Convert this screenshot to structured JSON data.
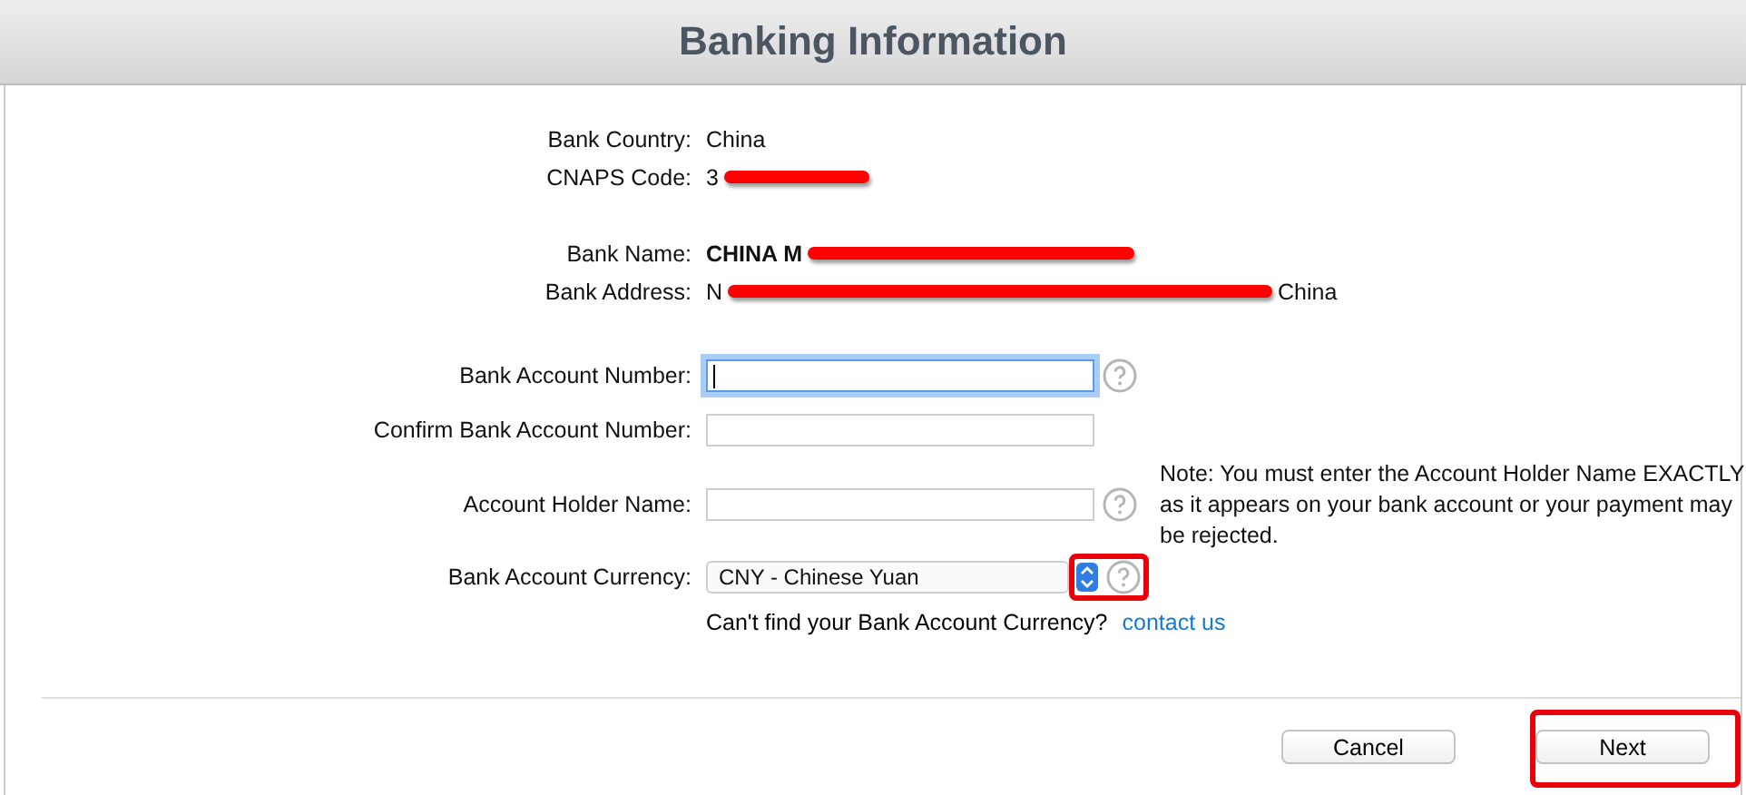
{
  "window": {
    "title": "Banking Information"
  },
  "bank_details": [
    {
      "rows": [
        {
          "label": "Bank Country:",
          "value": "China",
          "bold": false,
          "redacted": false
        },
        {
          "label": "CNAPS Code:",
          "value": "3",
          "bold": false,
          "redacted": true
        }
      ]
    },
    {
      "rows": [
        {
          "label": "Bank Name:",
          "value": "CHINA M",
          "bold": true,
          "redacted": true
        },
        {
          "label": "Bank Address:",
          "value": "N",
          "bold": false,
          "redacted": true,
          "suffix": "China"
        }
      ]
    }
  ],
  "fields": [
    {
      "label": "Bank Account Number:",
      "kind": "text",
      "focused": true,
      "help": true,
      "highlighted": false
    },
    {
      "label": "Confirm Bank Account Number:",
      "kind": "text",
      "focused": false,
      "help": false,
      "highlighted": false
    },
    {
      "label": "Account Holder Name:",
      "kind": "text",
      "focused": false,
      "help": true,
      "highlighted": false,
      "note": "Note: You must enter the Account Holder Name EXACTLY as it appears on your bank account or your payment may be rejected."
    },
    {
      "label": "Bank Account Currency:",
      "kind": "select",
      "value": "CNY - Chinese Yuan",
      "help": true,
      "highlighted": true
    }
  ],
  "currency_hint": {
    "text": "Can't find your Bank Account Currency?",
    "link": "contact us"
  },
  "buttons": [
    {
      "label": "Cancel",
      "highlighted": false
    },
    {
      "label": "Next",
      "highlighted": true
    }
  ]
}
